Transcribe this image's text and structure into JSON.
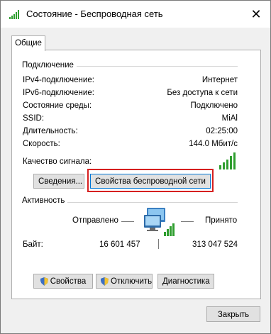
{
  "window": {
    "title": "Состояние - Беспроводная сеть",
    "close_glyph": "✕"
  },
  "tabs": [
    {
      "label": "Общие"
    }
  ],
  "connection": {
    "heading": "Подключение",
    "rows": [
      {
        "label": "IPv4-подключение:",
        "value": "Интернет"
      },
      {
        "label": "IPv6-подключение:",
        "value": "Без доступа к сети"
      },
      {
        "label": "Состояние среды:",
        "value": "Подключено"
      },
      {
        "label": "SSID:",
        "value": "MiAl"
      },
      {
        "label": "Длительность:",
        "value": "02:25:00"
      },
      {
        "label": "Скорость:",
        "value": "144.0 Мбит/с"
      }
    ],
    "signal_label": "Качество сигнала:",
    "signal_bars_lit": 5,
    "signal_bars_total": 5,
    "details_button": "Сведения...",
    "wireless_props_button": "Свойства беспроводной сети"
  },
  "activity": {
    "heading": "Активность",
    "sent_label": "Отправлено",
    "received_label": "Принято",
    "bytes_label": "Байт:",
    "bytes_sent": "16 601 457",
    "bytes_received": "313 047 524",
    "network_icon": "network-computers-icon"
  },
  "actions": {
    "properties_button": "Свойства",
    "disconnect_button": "Отключить",
    "diagnose_button": "Диагностика"
  },
  "footer": {
    "close_button": "Закрыть"
  },
  "colors": {
    "accent": "#0078d7",
    "highlight": "#d62020",
    "signal": "#2f9e2f"
  }
}
